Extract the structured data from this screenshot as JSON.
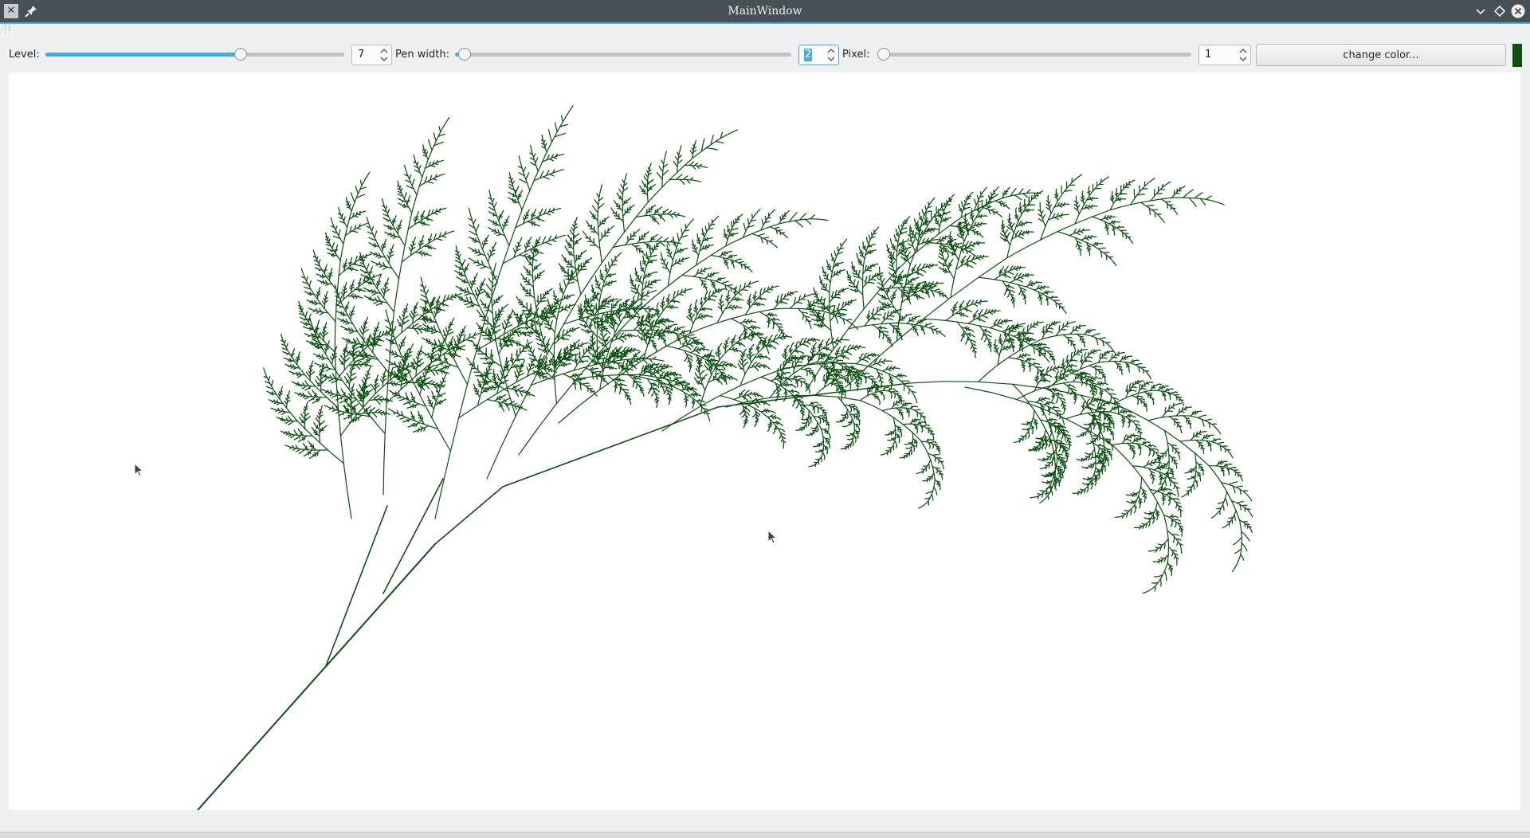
{
  "window": {
    "title": "MainWindow"
  },
  "toolbar": {
    "level_label": "Level:",
    "level_value": "7",
    "level_slider_fraction": 0.66,
    "pen_width_label": "Pen width:",
    "pen_width_value": "2",
    "pen_width_slider_fraction": 0.01,
    "pixel_label": "Pixel:",
    "pixel_value": "1",
    "pixel_slider_fraction": 0.0,
    "change_color_label": "change color...",
    "current_color": "#0b5110"
  },
  "colors": {
    "titlebar": "#475057",
    "accent": "#3daee9",
    "fractal": "#0b5110",
    "canvas": "#ffffff"
  },
  "icons": [
    "app-icon",
    "pin-icon",
    "minimize-icon",
    "maximize-icon",
    "close-icon",
    "mouse-cursor-icon"
  ]
}
